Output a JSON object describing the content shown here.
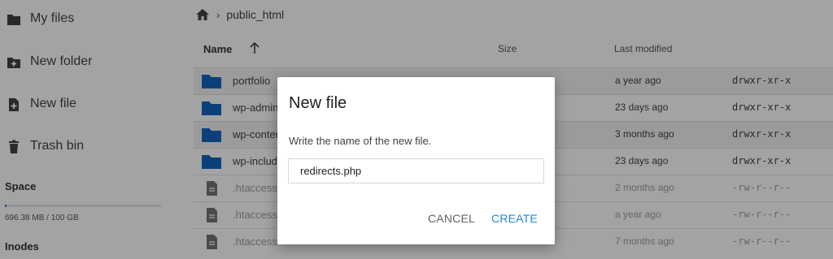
{
  "sidebar": {
    "items": [
      {
        "label": "My files",
        "icon": "folder-icon"
      },
      {
        "label": "New folder",
        "icon": "folder-plus-icon"
      },
      {
        "label": "New file",
        "icon": "file-plus-icon"
      },
      {
        "label": "Trash bin",
        "icon": "trash-icon"
      }
    ],
    "space": {
      "title": "Space",
      "usage_text": "696.38 MB / 100 GB",
      "used_fraction": 0.007
    },
    "inodes": {
      "title": "Inodes"
    }
  },
  "breadcrumb": {
    "current": "public_html"
  },
  "table": {
    "columns": {
      "name": "Name",
      "size": "Size",
      "modified": "Last modified"
    },
    "rows": [
      {
        "name": "portfolio",
        "modified": "a year ago",
        "perm": "drwxr-xr-x",
        "kind": "folder"
      },
      {
        "name": "wp-admin",
        "modified": "23 days ago",
        "perm": "drwxr-xr-x",
        "kind": "folder"
      },
      {
        "name": "wp-content",
        "modified": "3 months ago",
        "perm": "drwxr-xr-x",
        "kind": "folder"
      },
      {
        "name": "wp-includes",
        "modified": "23 days ago",
        "perm": "drwxr-xr-x",
        "kind": "folder"
      },
      {
        "name": ".htaccess",
        "modified": "2 months ago",
        "perm": "-rw-r--r--",
        "kind": "file"
      },
      {
        "name": ".htaccess",
        "modified": "a year ago",
        "perm": "-rw-r--r--",
        "kind": "file"
      },
      {
        "name": ".htaccess",
        "modified": "7 months ago",
        "perm": "-rw-r--r--",
        "kind": "file"
      }
    ]
  },
  "dialog": {
    "title": "New file",
    "description": "Write the name of the new file.",
    "input_value": "redirects.php",
    "cancel_label": "CANCEL",
    "create_label": "CREATE"
  },
  "colors": {
    "accent": "#1e88e5",
    "folder": "#1565c0"
  }
}
